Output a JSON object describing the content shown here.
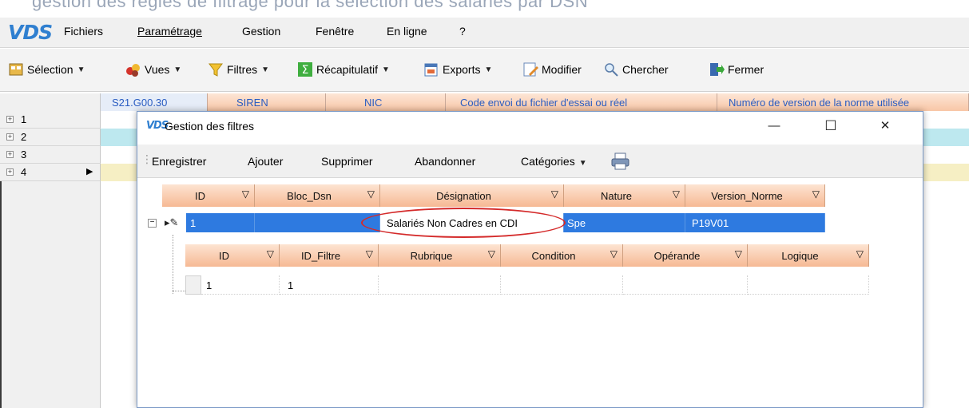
{
  "caption": "gestion des règles de filtrage pour la sélection des salariés par DSN",
  "app": {
    "logo": "VDS"
  },
  "menu": [
    {
      "label": "Fichiers"
    },
    {
      "label": "Paramétrage"
    },
    {
      "label": "Gestion"
    },
    {
      "label": "Fenêtre"
    },
    {
      "label": "En ligne"
    },
    {
      "label": "?"
    }
  ],
  "toolbar": {
    "selection": "Sélection",
    "vues": "Vues",
    "filtres": "Filtres",
    "recap": "Récapitulatif",
    "exports": "Exports",
    "modifier": "Modifier",
    "chercher": "Chercher",
    "fermer": "Fermer"
  },
  "main_grid": {
    "columns": [
      {
        "label": "S21.G00.30"
      },
      {
        "label": "SIREN"
      },
      {
        "label": "NIC"
      },
      {
        "label": "Code envoi du fichier d'essai ou réel"
      },
      {
        "label": "Numéro de version de la norme utilisée"
      }
    ],
    "rows": [
      "1",
      "2",
      "3",
      "4"
    ]
  },
  "dialog": {
    "logo": "VDS",
    "title": "Gestion des filtres",
    "controls": {
      "minimize": "—",
      "maximize": "☐",
      "close": "✕"
    },
    "toolbar": {
      "enregistrer": "Enregistrer",
      "ajouter": "Ajouter",
      "supprimer": "Supprimer",
      "abandonner": "Abandonner",
      "categories": "Catégories"
    },
    "filters_grid": {
      "columns": [
        "ID",
        "Bloc_Dsn",
        "Désignation",
        "Nature",
        "Version_Norme"
      ],
      "row": {
        "id": "1",
        "bloc_dsn": "",
        "designation": "Salariés Non Cadres en CDI",
        "nature": "Spe",
        "version_norme": "P19V01"
      }
    },
    "conditions_grid": {
      "columns": [
        "ID",
        "ID_Filtre",
        "Rubrique",
        "Condition",
        "Opérande",
        "Logique"
      ],
      "row": {
        "id": "1",
        "id_filtre": "1",
        "rubrique": "",
        "condition": "",
        "operande": "",
        "logique": ""
      }
    }
  },
  "colors": {
    "accent": "#2e7ae0",
    "header_orange": "#f6b994",
    "highlight_ellipse": "#d42a2a"
  }
}
